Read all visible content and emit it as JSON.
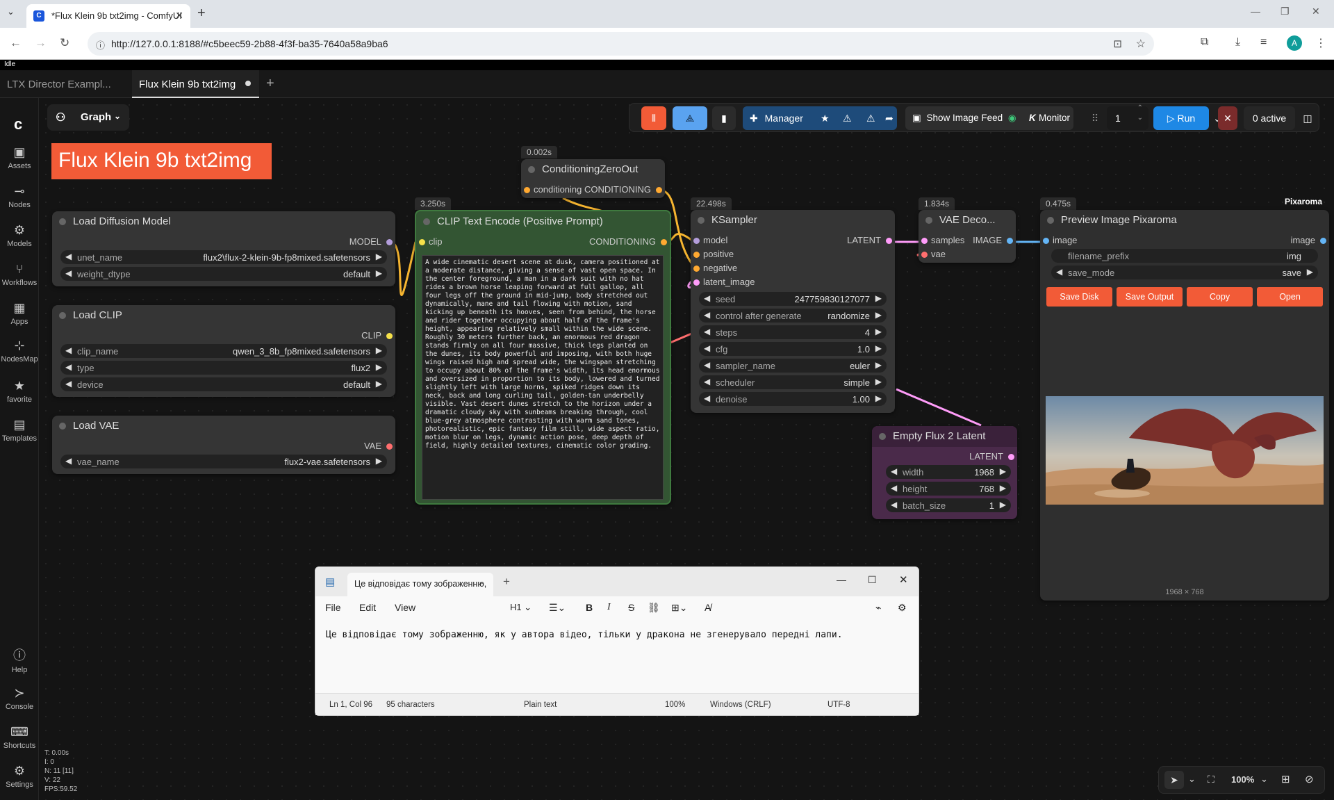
{
  "browser": {
    "tab_title": "*Flux Klein 9b txt2img - ComfyUI",
    "url": "http://127.0.0.1:8188/#c5beec59-2b88-4f3f-ba35-7640a58a9ba6",
    "avatar_letter": "A"
  },
  "status": {
    "label": "Idle"
  },
  "workflow_tabs": [
    {
      "label": "LTX Director Exampl..."
    },
    {
      "label": "Flux Klein 9b txt2img"
    }
  ],
  "sidebar": {
    "items": [
      {
        "label": "Assets",
        "icon": "image-icon"
      },
      {
        "label": "Nodes",
        "icon": "nodes-icon"
      },
      {
        "label": "Models",
        "icon": "models-icon"
      },
      {
        "label": "Workflows",
        "icon": "workflows-icon"
      },
      {
        "label": "Apps",
        "icon": "apps-icon"
      },
      {
        "label": "NodesMap",
        "icon": "nodesmap-icon"
      },
      {
        "label": "favorite",
        "icon": "star-icon"
      },
      {
        "label": "Templates",
        "icon": "templates-icon"
      },
      {
        "label": "Help",
        "icon": "help-icon"
      },
      {
        "label": "Console",
        "icon": "console-icon"
      },
      {
        "label": "Shortcuts",
        "icon": "keyboard-icon"
      },
      {
        "label": "Settings",
        "icon": "gear-icon"
      }
    ]
  },
  "graph_button": {
    "label": "Graph"
  },
  "workflow_title": "Flux Klein 9b txt2img",
  "toolbar": {
    "manager_label": "Manager",
    "show_image_feed_label": "Show Image Feed",
    "monitor_label": "Monitor",
    "queue_count": "1",
    "run_label": "Run",
    "active_label": "0 active"
  },
  "nodes": {
    "load_diffusion": {
      "title": "Load Diffusion Model",
      "out": "MODEL",
      "w1_label": "unet_name",
      "w1_value": "flux2\\flux-2-klein-9b-fp8mixed.safetensors",
      "w2_label": "weight_dtype",
      "w2_value": "default"
    },
    "load_clip": {
      "title": "Load CLIP",
      "out": "CLIP",
      "w1_label": "clip_name",
      "w1_value": "qwen_3_8b_fp8mixed.safetensors",
      "w2_label": "type",
      "w2_value": "flux2",
      "w3_label": "device",
      "w3_value": "default"
    },
    "load_vae": {
      "title": "Load VAE",
      "out": "VAE",
      "w1_label": "vae_name",
      "w1_value": "flux2-vae.safetensors"
    },
    "clip_text": {
      "timing": "3.250s",
      "title": "CLIP Text Encode (Positive Prompt)",
      "in": "clip",
      "out": "CONDITIONING",
      "prompt": "A wide cinematic desert scene at dusk, camera positioned at a moderate distance, giving a sense of vast open space. In the center foreground, a man in a dark suit with no hat rides a brown horse leaping forward at full gallop, all four legs off the ground in mid-jump, body stretched out dynamically, mane and tail flowing with motion, sand kicking up beneath its hooves, seen from behind, the horse and rider together occupying about half of the frame's height, appearing relatively small within the wide scene. Roughly 30 meters further back, an enormous red dragon stands firmly on all four massive, thick legs planted on the dunes, its body powerful and imposing, with both huge wings raised high and spread wide, the wingspan stretching to occupy about 80% of the frame's width, its head enormous and oversized in proportion to its body, lowered and turned slightly left with large horns, spiked ridges down its neck, back and long curling tail, golden-tan underbelly visible. Vast desert dunes stretch to the horizon under a dramatic cloudy sky with sunbeams breaking through, cool blue-grey atmosphere contrasting with warm sand tones, photorealistic, epic fantasy film still, wide aspect ratio, motion blur on legs, dynamic action pose, deep depth of field, highly detailed textures, cinematic color grading."
    },
    "zero_out": {
      "timing": "0.002s",
      "title": "ConditioningZeroOut",
      "in": "conditioning",
      "out": "CONDITIONING"
    },
    "ksampler": {
      "timing": "22.498s",
      "title": "KSampler",
      "in": [
        "model",
        "positive",
        "negative",
        "latent_image"
      ],
      "out": "LATENT",
      "widgets": [
        {
          "label": "seed",
          "value": "247759830127077"
        },
        {
          "label": "control after generate",
          "value": "randomize"
        },
        {
          "label": "steps",
          "value": "4"
        },
        {
          "label": "cfg",
          "value": "1.0"
        },
        {
          "label": "sampler_name",
          "value": "euler"
        },
        {
          "label": "scheduler",
          "value": "simple"
        },
        {
          "label": "denoise",
          "value": "1.00"
        }
      ]
    },
    "vae_decode": {
      "timing": "1.834s",
      "title": "VAE Deco...",
      "in": [
        "samples",
        "vae"
      ],
      "out": "IMAGE"
    },
    "empty_latent": {
      "title": "Empty Flux 2 Latent",
      "out": "LATENT",
      "widgets": [
        {
          "label": "width",
          "value": "1968"
        },
        {
          "label": "height",
          "value": "768"
        },
        {
          "label": "batch_size",
          "value": "1"
        }
      ]
    },
    "preview": {
      "timing": "0.475s",
      "badge": "Pixaroma",
      "title": "Preview Image Pixaroma",
      "in": "image",
      "out": "image",
      "w1_label": "filename_prefix",
      "w1_value": "img",
      "w2_label": "save_mode",
      "w2_value": "save",
      "buttons": [
        "Save Disk",
        "Save Output",
        "Copy",
        "Open"
      ],
      "dims": "1968 × 768"
    }
  },
  "notepad": {
    "tab_title": "Це відповідає тому зображенню,",
    "menu": [
      "File",
      "Edit",
      "View"
    ],
    "heading": "H1",
    "text": "Це відповідає тому зображенню, як у автора відео, тільки у дракона не згенерувало передні лапи.",
    "status": {
      "pos": "Ln 1, Col 96",
      "chars": "95 characters",
      "type": "Plain text",
      "zoom": "100%",
      "eol": "Windows (CRLF)",
      "enc": "UTF-8"
    }
  },
  "perf": [
    "T: 0.00s",
    "I: 0",
    "N: 11 [11]",
    "V: 22",
    "FPS:59.52"
  ],
  "zoom": "100%",
  "colors": {
    "accent": "#f25b37",
    "run": "#1e88e5",
    "clip_node": "#335533",
    "latent_node": "#4a2a4a"
  }
}
